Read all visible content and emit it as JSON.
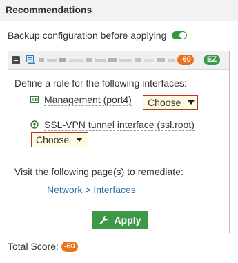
{
  "header": {
    "title": "Recommendations"
  },
  "backup": {
    "label": "Backup configuration before applying",
    "enabled": true
  },
  "panel": {
    "score_badge": "-60",
    "ez_badge": "EZ",
    "define_text": "Define a role for the following interfaces:",
    "interfaces": [
      {
        "label": "Management (port4)",
        "select_value": "Choose",
        "icon": "port-icon"
      },
      {
        "label": "SSL-VPN tunnel interface (ssl.root)",
        "select_value": "Choose",
        "icon": "ssl-tunnel-icon"
      }
    ],
    "visit_text": "Visit the following page(s) to remediate:",
    "link": "Network > Interfaces",
    "apply_label": "Apply"
  },
  "total": {
    "label": "Total Score:",
    "value": "-60"
  },
  "colors": {
    "accent_green": "#3c9a46",
    "badge_orange": "#e8731b",
    "link_blue": "#2a6fa8",
    "invalid_border": "#b33a2a"
  }
}
